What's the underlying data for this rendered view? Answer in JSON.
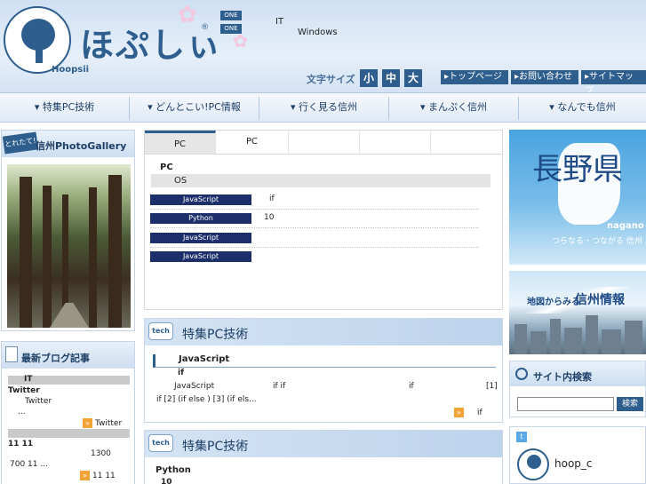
{
  "header": {
    "logo_text": "ほぷしぃ",
    "logo_sub": "Hoopsii",
    "logo_reg": "®",
    "badge_1": "ONE",
    "badge_2": "ONE",
    "tagline_1": "IT",
    "tagline_2": "Windows",
    "font_size_label": "文字サイズ",
    "font_sizes": [
      "小",
      "中",
      "大"
    ],
    "top_links": [
      "▸トップページ",
      "▸お問い合わせ",
      "▸サイトマップ"
    ]
  },
  "nav": {
    "items": [
      "▾ 特集PC技術",
      "▾ どんとこい!PC情報",
      "▾ 行く見る信州",
      "▾ まんぷく信州",
      "▾ なんでも信州"
    ]
  },
  "photo_gallery": {
    "tag": "とれたて!",
    "title": "信州PhotoGallery"
  },
  "blog": {
    "title": "最新ブログ記事",
    "bar1_text": "IT",
    "label_twitter": "Twitter",
    "line_twitter": "Twitter",
    "line_ellipsis": "...",
    "link_twitter": "Twitter",
    "heading_1111": "11  11",
    "line_1300": "1300",
    "line_700": "700 11 ...",
    "link_1111": "11 11"
  },
  "tabs": [
    "PC",
    "PC",
    "",
    "",
    ""
  ],
  "tab_panel": {
    "heading": "PC",
    "os_bar": "OS",
    "rows": [
      {
        "tag": "JavaScript",
        "note": "if"
      },
      {
        "tag": "Python",
        "note": "10"
      },
      {
        "tag": "JavaScript",
        "note": ""
      },
      {
        "tag": "JavaScript",
        "note": ""
      }
    ]
  },
  "section_1": {
    "icon": "tech",
    "title": "特集PC技術",
    "article_title": "JavaScript",
    "article_sub": "if",
    "line_1": "JavaScript",
    "line_1b": "if   if",
    "line_1c": "if",
    "line_1d": "[1]",
    "line_2": "if   [2]       (if else ) [3]      (if els...",
    "more": "if"
  },
  "section_2": {
    "icon": "tech",
    "title": "特集PC技術",
    "article_title": "Python",
    "article_sub": "10"
  },
  "right": {
    "nagano_title": "長野県",
    "nagano_en": "nagano",
    "nagano_tagline": "つらなる・つながる 信州",
    "map_small": "地図からみる",
    "map_big": "信州情報",
    "search_title": "サイト内検索",
    "search_placeholder": "",
    "search_button": "検索",
    "twitter_name": "hoop_c"
  },
  "colors": {
    "brand": "#2e5e8e",
    "tag_navy": "#1d2f6b",
    "accent_orange": "#f2a336"
  }
}
